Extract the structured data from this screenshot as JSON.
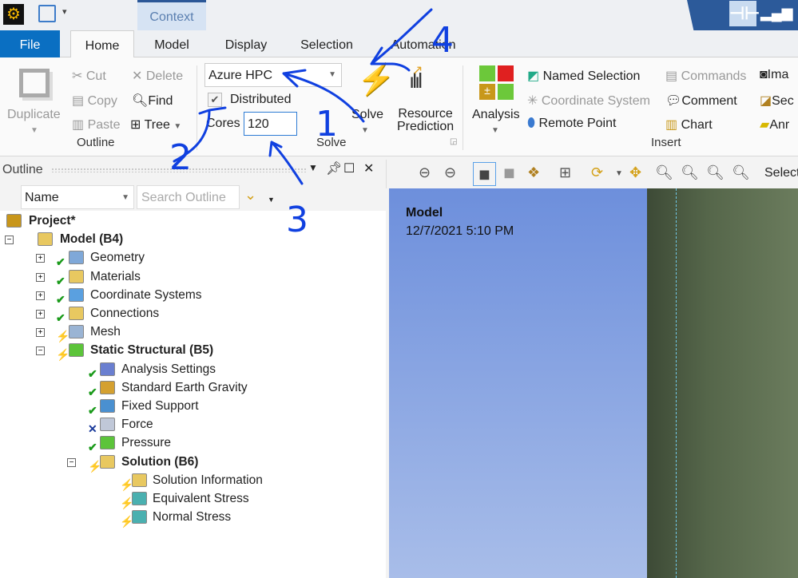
{
  "title_bar": {
    "context_tab": "Context",
    "qa_dropdown": "▾"
  },
  "tabs": [
    "File",
    "Home",
    "Model",
    "Display",
    "Selection",
    "Automation"
  ],
  "ribbon": {
    "outline_group": {
      "label": "Outline",
      "duplicate": "Duplicate",
      "cut": "Cut",
      "copy": "Copy",
      "paste": "Paste",
      "delete": "Delete",
      "find": "Find",
      "tree": "Tree"
    },
    "solve_group": {
      "label": "Solve",
      "solver": "Azure HPC",
      "distributed_label": "Distributed",
      "distributed_checked": true,
      "cores_label": "Cores",
      "cores_value": "120",
      "solve": "Solve",
      "resource_prediction_1": "Resource",
      "resource_prediction_2": "Prediction"
    },
    "analysis": "Analysis",
    "insert_group": {
      "label": "Insert",
      "named_selection": "Named Selection",
      "coordinate_system": "Coordinate System",
      "remote_point": "Remote Point",
      "commands": "Commands",
      "comment": "Comment",
      "chart": "Chart",
      "images": "Ima",
      "section": "Sec",
      "annotation": "Anr"
    }
  },
  "outline": {
    "title": "Outline",
    "name_filter": "Name",
    "search_placeholder": "Search Outline",
    "tree": [
      {
        "label": "Project*",
        "level": 0,
        "bold": true,
        "expander": "",
        "status": "",
        "icon": "project-icon",
        "color": "#c8961a"
      },
      {
        "label": "Model (B4)",
        "level": 1,
        "bold": true,
        "expander": "-",
        "status": "",
        "icon": "model-folder-icon",
        "color": "#e8c860"
      },
      {
        "label": "Geometry",
        "level": 2,
        "expander": "+",
        "status": "check",
        "icon": "geometry-icon",
        "color": "#7fa8d8"
      },
      {
        "label": "Materials",
        "level": 2,
        "expander": "+",
        "status": "check",
        "icon": "materials-folder-icon",
        "color": "#e8c860"
      },
      {
        "label": "Coordinate Systems",
        "level": 2,
        "expander": "+",
        "status": "check",
        "icon": "coordinate-systems-icon",
        "color": "#5aa0e0"
      },
      {
        "label": "Connections",
        "level": 2,
        "expander": "+",
        "status": "check",
        "icon": "connections-folder-icon",
        "color": "#e8c860"
      },
      {
        "label": "Mesh",
        "level": 2,
        "expander": "+",
        "status": "bolt",
        "icon": "mesh-icon",
        "color": "#9ab4d4"
      },
      {
        "label": "Static Structural (B5)",
        "level": 2,
        "bold": true,
        "expander": "-",
        "status": "bolt",
        "icon": "static-structural-icon",
        "color": "#5cc43a"
      },
      {
        "label": "Analysis Settings",
        "level": 3,
        "expander": "",
        "status": "check",
        "icon": "analysis-settings-icon",
        "color": "#6a7fd0"
      },
      {
        "label": "Standard Earth Gravity",
        "level": 3,
        "expander": "",
        "status": "check",
        "icon": "gravity-icon",
        "color": "#d4a030"
      },
      {
        "label": "Fixed Support",
        "level": 3,
        "expander": "",
        "status": "check",
        "icon": "fixed-support-icon",
        "color": "#4a90d0"
      },
      {
        "label": "Force",
        "level": 3,
        "expander": "",
        "status": "x",
        "icon": "force-icon",
        "color": "#c0c8d8"
      },
      {
        "label": "Pressure",
        "level": 3,
        "expander": "",
        "status": "check",
        "icon": "pressure-icon",
        "color": "#5cc43a"
      },
      {
        "label": "Solution (B6)",
        "level": 3,
        "bold": true,
        "expander": "-",
        "status": "bolt",
        "icon": "solution-folder-icon",
        "color": "#e8c860"
      },
      {
        "label": "Solution Information",
        "level": 4,
        "expander": "",
        "status": "bolt",
        "icon": "solution-information-icon",
        "color": "#e8c860"
      },
      {
        "label": "Equivalent Stress",
        "level": 4,
        "expander": "",
        "status": "bolt",
        "icon": "equivalent-stress-icon",
        "color": "#4ab0b0"
      },
      {
        "label": "Normal Stress",
        "level": 4,
        "expander": "",
        "status": "bolt",
        "icon": "normal-stress-icon",
        "color": "#4ab0b0"
      }
    ]
  },
  "viewport": {
    "select_label": "Select",
    "model_title": "Model",
    "model_date": "12/7/2021 5:10 PM"
  },
  "annotations": {
    "n1": "1",
    "n2": "2",
    "n3": "3",
    "n4": "4",
    "color": "#1040e0"
  }
}
